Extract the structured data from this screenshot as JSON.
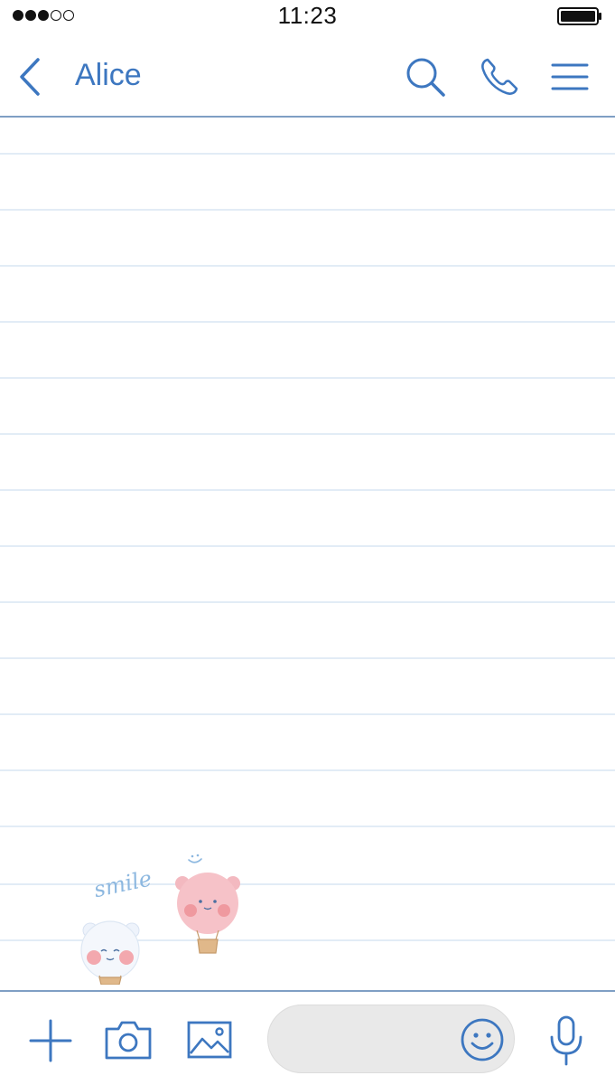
{
  "status_bar": {
    "time": "11:23",
    "signal_bars_filled": 3,
    "signal_bars_total": 5,
    "battery_icon": "battery-full-icon"
  },
  "header": {
    "back_icon": "chevron-left-icon",
    "title": "Alice",
    "actions": [
      {
        "icon": "search-icon"
      },
      {
        "icon": "phone-icon"
      },
      {
        "icon": "menu-icon"
      }
    ]
  },
  "chat": {
    "messages": [],
    "sticker": {
      "text": "smile",
      "icon": "bear-balloons-sticker"
    }
  },
  "toolbar": {
    "add_icon": "plus-icon",
    "camera_icon": "camera-icon",
    "gallery_icon": "image-icon",
    "message_input": {
      "value": "",
      "placeholder": ""
    },
    "emoji_icon": "smiley-icon",
    "mic_icon": "microphone-icon"
  },
  "colors": {
    "accent": "#3d77c0",
    "divider": "#7f9fc4",
    "ruled_line": "#e2ecf6",
    "input_bg": "#e9e9e9"
  }
}
